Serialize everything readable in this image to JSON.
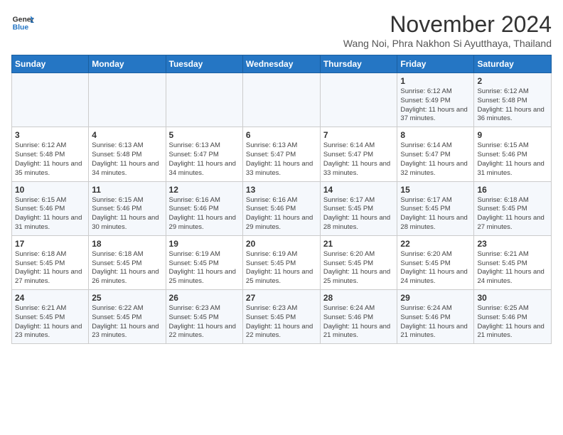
{
  "header": {
    "logo_line1": "General",
    "logo_line2": "Blue",
    "month": "November 2024",
    "location": "Wang Noi, Phra Nakhon Si Ayutthaya, Thailand"
  },
  "weekdays": [
    "Sunday",
    "Monday",
    "Tuesday",
    "Wednesday",
    "Thursday",
    "Friday",
    "Saturday"
  ],
  "weeks": [
    [
      {
        "day": "",
        "info": ""
      },
      {
        "day": "",
        "info": ""
      },
      {
        "day": "",
        "info": ""
      },
      {
        "day": "",
        "info": ""
      },
      {
        "day": "",
        "info": ""
      },
      {
        "day": "1",
        "info": "Sunrise: 6:12 AM\nSunset: 5:49 PM\nDaylight: 11 hours and 37 minutes."
      },
      {
        "day": "2",
        "info": "Sunrise: 6:12 AM\nSunset: 5:48 PM\nDaylight: 11 hours and 36 minutes."
      }
    ],
    [
      {
        "day": "3",
        "info": "Sunrise: 6:12 AM\nSunset: 5:48 PM\nDaylight: 11 hours and 35 minutes."
      },
      {
        "day": "4",
        "info": "Sunrise: 6:13 AM\nSunset: 5:48 PM\nDaylight: 11 hours and 34 minutes."
      },
      {
        "day": "5",
        "info": "Sunrise: 6:13 AM\nSunset: 5:47 PM\nDaylight: 11 hours and 34 minutes."
      },
      {
        "day": "6",
        "info": "Sunrise: 6:13 AM\nSunset: 5:47 PM\nDaylight: 11 hours and 33 minutes."
      },
      {
        "day": "7",
        "info": "Sunrise: 6:14 AM\nSunset: 5:47 PM\nDaylight: 11 hours and 33 minutes."
      },
      {
        "day": "8",
        "info": "Sunrise: 6:14 AM\nSunset: 5:47 PM\nDaylight: 11 hours and 32 minutes."
      },
      {
        "day": "9",
        "info": "Sunrise: 6:15 AM\nSunset: 5:46 PM\nDaylight: 11 hours and 31 minutes."
      }
    ],
    [
      {
        "day": "10",
        "info": "Sunrise: 6:15 AM\nSunset: 5:46 PM\nDaylight: 11 hours and 31 minutes."
      },
      {
        "day": "11",
        "info": "Sunrise: 6:15 AM\nSunset: 5:46 PM\nDaylight: 11 hours and 30 minutes."
      },
      {
        "day": "12",
        "info": "Sunrise: 6:16 AM\nSunset: 5:46 PM\nDaylight: 11 hours and 29 minutes."
      },
      {
        "day": "13",
        "info": "Sunrise: 6:16 AM\nSunset: 5:46 PM\nDaylight: 11 hours and 29 minutes."
      },
      {
        "day": "14",
        "info": "Sunrise: 6:17 AM\nSunset: 5:45 PM\nDaylight: 11 hours and 28 minutes."
      },
      {
        "day": "15",
        "info": "Sunrise: 6:17 AM\nSunset: 5:45 PM\nDaylight: 11 hours and 28 minutes."
      },
      {
        "day": "16",
        "info": "Sunrise: 6:18 AM\nSunset: 5:45 PM\nDaylight: 11 hours and 27 minutes."
      }
    ],
    [
      {
        "day": "17",
        "info": "Sunrise: 6:18 AM\nSunset: 5:45 PM\nDaylight: 11 hours and 27 minutes."
      },
      {
        "day": "18",
        "info": "Sunrise: 6:18 AM\nSunset: 5:45 PM\nDaylight: 11 hours and 26 minutes."
      },
      {
        "day": "19",
        "info": "Sunrise: 6:19 AM\nSunset: 5:45 PM\nDaylight: 11 hours and 25 minutes."
      },
      {
        "day": "20",
        "info": "Sunrise: 6:19 AM\nSunset: 5:45 PM\nDaylight: 11 hours and 25 minutes."
      },
      {
        "day": "21",
        "info": "Sunrise: 6:20 AM\nSunset: 5:45 PM\nDaylight: 11 hours and 25 minutes."
      },
      {
        "day": "22",
        "info": "Sunrise: 6:20 AM\nSunset: 5:45 PM\nDaylight: 11 hours and 24 minutes."
      },
      {
        "day": "23",
        "info": "Sunrise: 6:21 AM\nSunset: 5:45 PM\nDaylight: 11 hours and 24 minutes."
      }
    ],
    [
      {
        "day": "24",
        "info": "Sunrise: 6:21 AM\nSunset: 5:45 PM\nDaylight: 11 hours and 23 minutes."
      },
      {
        "day": "25",
        "info": "Sunrise: 6:22 AM\nSunset: 5:45 PM\nDaylight: 11 hours and 23 minutes."
      },
      {
        "day": "26",
        "info": "Sunrise: 6:23 AM\nSunset: 5:45 PM\nDaylight: 11 hours and 22 minutes."
      },
      {
        "day": "27",
        "info": "Sunrise: 6:23 AM\nSunset: 5:45 PM\nDaylight: 11 hours and 22 minutes."
      },
      {
        "day": "28",
        "info": "Sunrise: 6:24 AM\nSunset: 5:46 PM\nDaylight: 11 hours and 21 minutes."
      },
      {
        "day": "29",
        "info": "Sunrise: 6:24 AM\nSunset: 5:46 PM\nDaylight: 11 hours and 21 minutes."
      },
      {
        "day": "30",
        "info": "Sunrise: 6:25 AM\nSunset: 5:46 PM\nDaylight: 11 hours and 21 minutes."
      }
    ]
  ]
}
